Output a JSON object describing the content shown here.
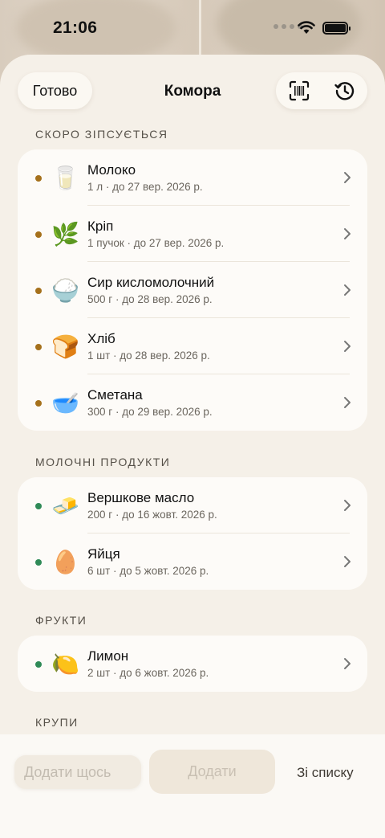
{
  "status_bar": {
    "time": "21:06"
  },
  "nav": {
    "done_label": "Готово",
    "title": "Комора",
    "scan_icon": "barcode-scan-icon",
    "history_icon": "history-icon"
  },
  "colors": {
    "expiring": "#a5701b",
    "fresh": "#2f8a57"
  },
  "sections": [
    {
      "title": "СКОРО ЗІПСУЄТЬСЯ",
      "items": [
        {
          "name": "Молоко",
          "meta": "1 л · до 27 вер. 2026 р.",
          "icon": "🥛",
          "status": "expiring"
        },
        {
          "name": "Кріп",
          "meta": "1 пучок · до 27 вер. 2026 р.",
          "icon": "🌿",
          "status": "expiring"
        },
        {
          "name": "Сир кисломолочний",
          "meta": "500 г · до 28 вер. 2026 р.",
          "icon": "🍚",
          "status": "expiring"
        },
        {
          "name": "Хліб",
          "meta": "1 шт · до 28 вер. 2026 р.",
          "icon": "🍞",
          "status": "expiring"
        },
        {
          "name": "Сметана",
          "meta": "300 г · до 29 вер. 2026 р.",
          "icon": "🥣",
          "status": "expiring"
        }
      ]
    },
    {
      "title": "МОЛОЧНІ ПРОДУКТИ",
      "items": [
        {
          "name": "Вершкове масло",
          "meta": "200 г · до 16 жовт. 2026 р.",
          "icon": "🧈",
          "status": "fresh"
        },
        {
          "name": "Яйця",
          "meta": "6 шт · до 5 жовт. 2026 р.",
          "icon": "🥚",
          "status": "fresh"
        }
      ]
    },
    {
      "title": "ФРУКТИ",
      "items": [
        {
          "name": "Лимон",
          "meta": "2 шт · до 6 жовт. 2026 р.",
          "icon": "🍋",
          "status": "fresh"
        }
      ]
    },
    {
      "title": "КРУПИ",
      "items": []
    }
  ],
  "bottom": {
    "placeholder": "Додати щось",
    "add_label": "Додати",
    "from_list_label": "Зі списку"
  }
}
